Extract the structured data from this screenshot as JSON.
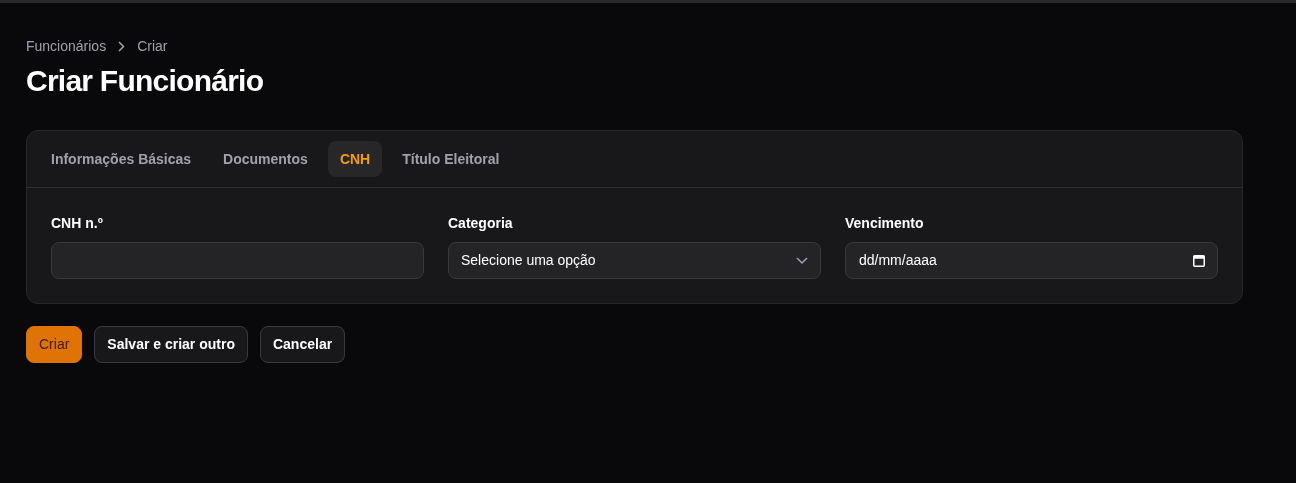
{
  "breadcrumb": [
    "Funcionários",
    "Criar"
  ],
  "title": "Criar Funcionário",
  "tabs": [
    {
      "label": "Informações Básicas",
      "selected": false
    },
    {
      "label": "Documentos",
      "selected": false
    },
    {
      "label": "CNH",
      "selected": true
    },
    {
      "label": "Título Eleitoral",
      "selected": false
    }
  ],
  "fields": [
    {
      "kind": "text",
      "label": "CNH n.º"
    },
    {
      "kind": "select",
      "label": "Categoria",
      "placeholder": "Selecione uma opção"
    },
    {
      "kind": "date",
      "label": "Vencimento",
      "value": "dd/mm/aaaa"
    }
  ],
  "buttons": [
    {
      "label": "Criar",
      "kind": "primary"
    },
    {
      "label": "Salvar e criar outro",
      "kind": "secondary"
    },
    {
      "label": "Cancelar",
      "kind": "secondary"
    }
  ]
}
